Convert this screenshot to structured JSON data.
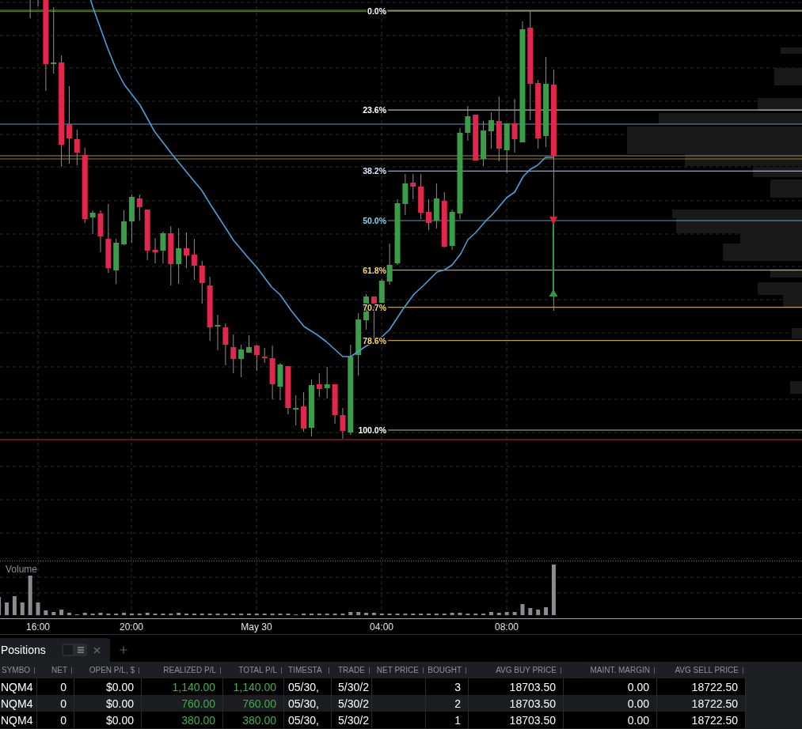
{
  "chart": {
    "fib_levels": [
      {
        "label": "0.0%",
        "color": "#ffffff"
      },
      {
        "label": "23.6%",
        "color": "#ffffff"
      },
      {
        "label": "38.2%",
        "color": "#d6e6ff"
      },
      {
        "label": "50.0%",
        "color": "#7fd6f7"
      },
      {
        "label": "61.8%",
        "color": "#ffd966"
      },
      {
        "label": "70.7%",
        "color": "#ffd966"
      },
      {
        "label": "78.6%",
        "color": "#ffd966"
      },
      {
        "label": "100.0%",
        "color": "#ffffff"
      }
    ],
    "volume_pane": {
      "title": "Volume"
    },
    "time_axis": {
      "labels": [
        "16:00",
        "20:00",
        "May 30",
        "04:00",
        "08:00"
      ]
    }
  },
  "bottom_panel": {
    "tabs": [
      {
        "label": "Positions",
        "selected": true
      }
    ],
    "table": {
      "columns": [
        {
          "label": "SYMBO",
          "kind": "text"
        },
        {
          "label": "NET",
          "kind": "number"
        },
        {
          "label": "OPEN P/L, $",
          "kind": "number"
        },
        {
          "label": "REALIZED P/L",
          "kind": "pnl"
        },
        {
          "label": "TOTAL P/L",
          "kind": "pnl"
        },
        {
          "label": "TIMESTA",
          "kind": "text"
        },
        {
          "label": "TRADE",
          "kind": "text"
        },
        {
          "label": "NET PRICE",
          "kind": "number"
        },
        {
          "label": "BOUGHT",
          "kind": "number"
        },
        {
          "label": "AVG BUY PRICE",
          "kind": "number"
        },
        {
          "label": "MAINT. MARGIN",
          "kind": "number"
        },
        {
          "label": "AVG SELL PRICE",
          "kind": "number"
        }
      ],
      "rows": [
        [
          "NQM4",
          "0",
          "$0.00",
          "1,140.00",
          "1,140.00",
          "05/30,",
          "5/30/2",
          null,
          "3",
          "18703.50",
          "0.00",
          "18722.50"
        ],
        [
          "NQM4",
          "0",
          "$0.00",
          "760.00",
          "760.00",
          "05/30,",
          "5/30/2",
          null,
          "2",
          "18703.50",
          "0.00",
          "18722.50"
        ],
        [
          "NQM4",
          "0",
          "$0.00",
          "380.00",
          "380.00",
          "05/30,",
          "5/30/2",
          null,
          "1",
          "18703.50",
          "0.00",
          "18722.50"
        ]
      ]
    }
  }
}
